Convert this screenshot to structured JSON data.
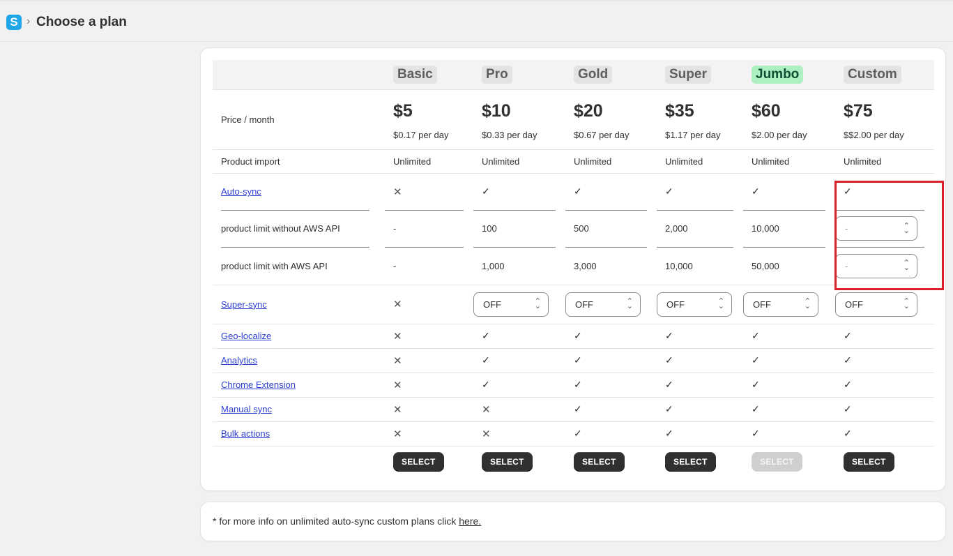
{
  "header": {
    "logo_letter": "S",
    "separator": "›",
    "title": "Choose a plan"
  },
  "plans": [
    {
      "name": "Basic",
      "price": "$5",
      "per_day": "$0.17 per day",
      "product_import": "Unlimited",
      "auto_sync": "✕",
      "limit_without_aws": "-",
      "limit_with_aws": "-",
      "super_sync": "✕",
      "geo_localize": "✕",
      "analytics": "✕",
      "chrome_extension": "✕",
      "manual_sync": "✕",
      "bulk_actions": "✕",
      "button": "SELECT"
    },
    {
      "name": "Pro",
      "price": "$10",
      "per_day": "$0.33 per day",
      "product_import": "Unlimited",
      "auto_sync": "✓",
      "limit_without_aws": "100",
      "limit_with_aws": "1,000",
      "super_sync": "OFF",
      "geo_localize": "✓",
      "analytics": "✓",
      "chrome_extension": "✓",
      "manual_sync": "✕",
      "bulk_actions": "✕",
      "button": "SELECT"
    },
    {
      "name": "Gold",
      "price": "$20",
      "per_day": "$0.67 per day",
      "product_import": "Unlimited",
      "auto_sync": "✓",
      "limit_without_aws": "500",
      "limit_with_aws": "3,000",
      "super_sync": "OFF",
      "geo_localize": "✓",
      "analytics": "✓",
      "chrome_extension": "✓",
      "manual_sync": "✓",
      "bulk_actions": "✓",
      "button": "SELECT"
    },
    {
      "name": "Super",
      "price": "$35",
      "per_day": "$1.17 per day",
      "product_import": "Unlimited",
      "auto_sync": "✓",
      "limit_without_aws": "2,000",
      "limit_with_aws": "10,000",
      "super_sync": "OFF",
      "geo_localize": "✓",
      "analytics": "✓",
      "chrome_extension": "✓",
      "manual_sync": "✓",
      "bulk_actions": "✓",
      "button": "SELECT"
    },
    {
      "name": "Jumbo",
      "price": "$60",
      "per_day": "$2.00 per day",
      "product_import": "Unlimited",
      "auto_sync": "✓",
      "limit_without_aws": "10,000",
      "limit_with_aws": "50,000",
      "super_sync": "OFF",
      "geo_localize": "✓",
      "analytics": "✓",
      "chrome_extension": "✓",
      "manual_sync": "✓",
      "bulk_actions": "✓",
      "button": "SELECT"
    },
    {
      "name": "Custom",
      "price": "$75",
      "per_day": "$$2.00 per day",
      "product_import": "Unlimited",
      "auto_sync": "✓",
      "limit_without_aws": "-",
      "limit_with_aws": "-",
      "super_sync": "OFF",
      "geo_localize": "✓",
      "analytics": "✓",
      "chrome_extension": "✓",
      "manual_sync": "✓",
      "bulk_actions": "✓",
      "button": "SELECT"
    }
  ],
  "row_labels": {
    "price": "Price / month",
    "product_import": "Product import",
    "auto_sync": "Auto-sync",
    "limit_without_aws": "product limit without AWS API",
    "limit_with_aws": "product limit with AWS API",
    "super_sync": "Super-sync",
    "geo_localize": "Geo-localize",
    "analytics": "Analytics",
    "chrome_extension": "Chrome Extension",
    "manual_sync": "Manual sync",
    "bulk_actions": "Bulk actions"
  },
  "footer": {
    "text": "* for more info on unlimited auto-sync custom plans click ",
    "link": "here."
  },
  "colors": {
    "accent_highlight": "#aff0c2",
    "button": "#303030",
    "link": "#2c3fd0",
    "annotation_box": "#d9202b"
  }
}
